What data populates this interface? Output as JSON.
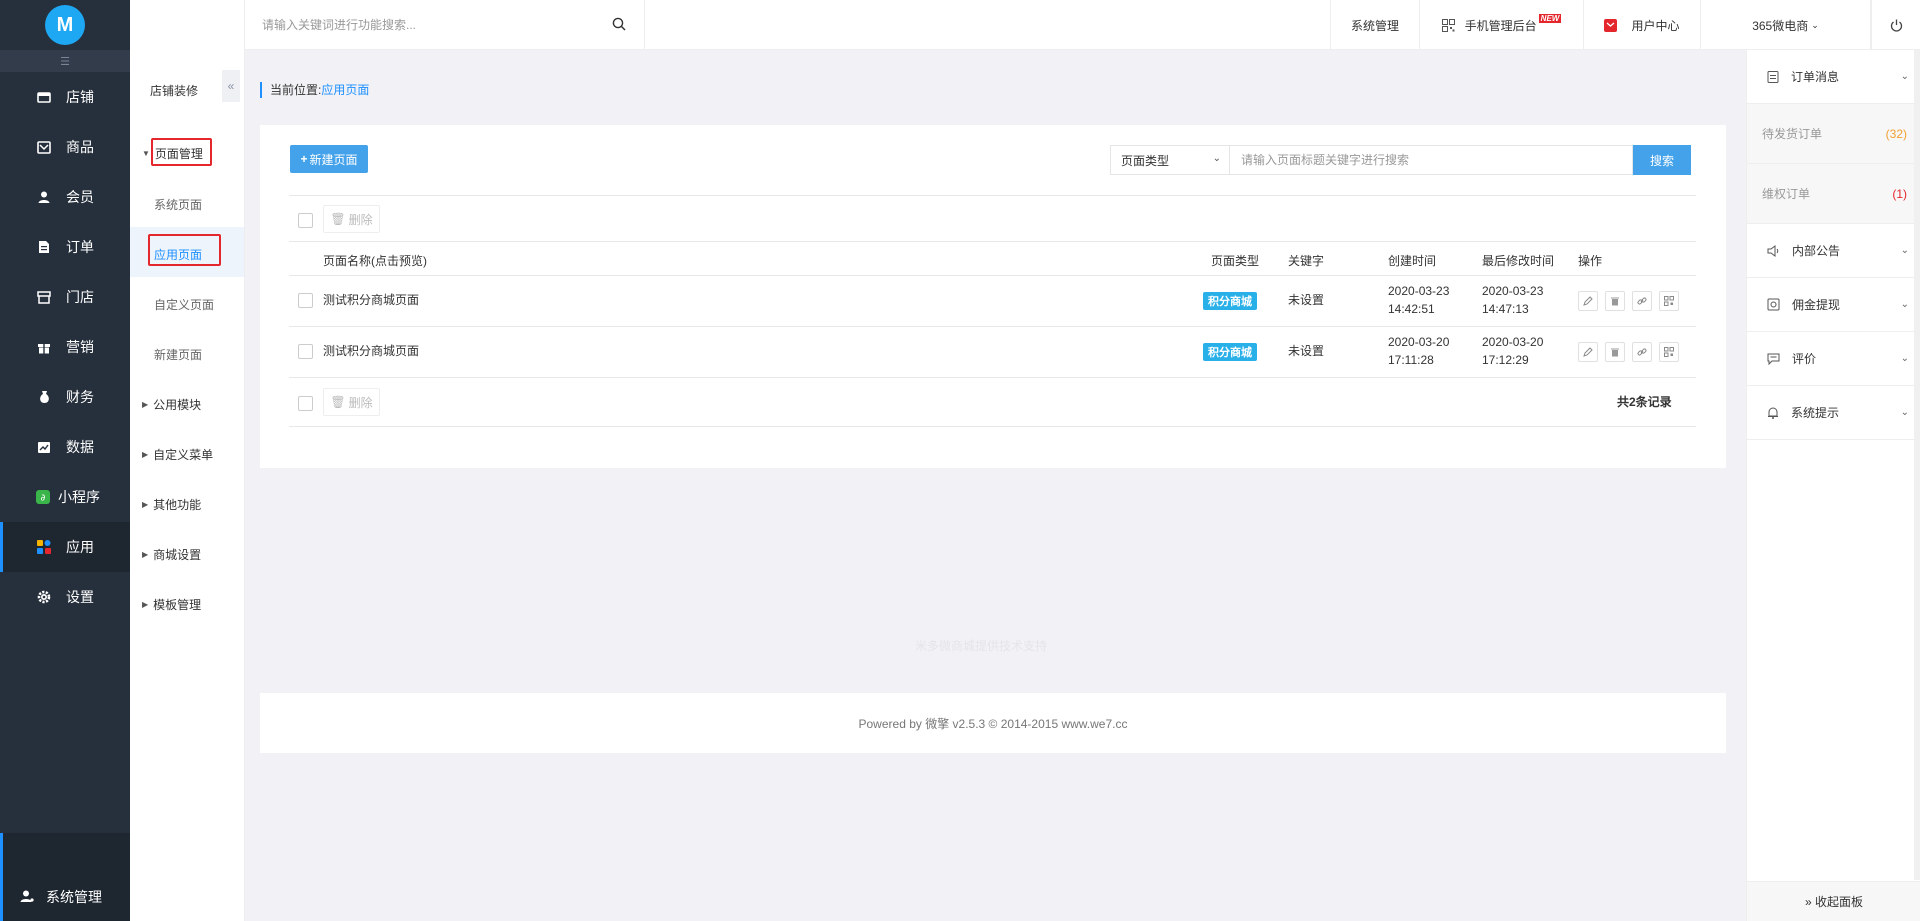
{
  "colors": {
    "sidebar_bg": "#262f3c",
    "accent": "#1e90ff",
    "button_blue": "#44a2ea",
    "tag_blue": "#2ab0e8",
    "highlight_red": "#e4262d",
    "count_orange": "#f0a030"
  },
  "logo": {
    "text": "M"
  },
  "sidebar": {
    "fold_icon": "indent-icon",
    "items": [
      {
        "label": "店铺",
        "icon": "store-icon"
      },
      {
        "label": "商品",
        "icon": "goods-icon"
      },
      {
        "label": "会员",
        "icon": "member-icon"
      },
      {
        "label": "订单",
        "icon": "order-icon"
      },
      {
        "label": "门店",
        "icon": "shop-icon"
      },
      {
        "label": "营销",
        "icon": "gift-icon"
      },
      {
        "label": "财务",
        "icon": "money-bag-icon"
      },
      {
        "label": "数据",
        "icon": "chart-icon"
      },
      {
        "label": "小程序",
        "icon": "mini-program-icon"
      },
      {
        "label": "应用",
        "icon": "apps-icon"
      },
      {
        "label": "设置",
        "icon": "gear-icon"
      }
    ],
    "active_index": 9,
    "bottom": {
      "label": "系统管理",
      "icon": "user-admin-icon"
    }
  },
  "submenu": {
    "title": "店铺装修",
    "groups": [
      {
        "label": "页面管理",
        "expanded": true,
        "children": [
          "系统页面",
          "应用页面",
          "自定义页面",
          "新建页面"
        ]
      },
      {
        "label": "公用模块"
      },
      {
        "label": "自定义菜单"
      },
      {
        "label": "其他功能"
      },
      {
        "label": "商城设置"
      },
      {
        "label": "模板管理"
      }
    ],
    "active_child": "应用页面"
  },
  "topbar": {
    "search_placeholder": "请输入关键词进行功能搜索...",
    "system_manage": "系统管理",
    "mobile_admin": "手机管理后台",
    "new_badge": "NEW",
    "user_center": "用户中心",
    "shop_name": "365微电商"
  },
  "breadcrumb": {
    "prefix": "当前位置:",
    "current": "应用页面"
  },
  "toolbar": {
    "new_button": "新建页面",
    "type_select": "页面类型",
    "keyword_placeholder": "请输入页面标题关键字进行搜索",
    "search_button": "搜索",
    "delete_button": "删除"
  },
  "table": {
    "headers": [
      "页面名称(点击预览)",
      "页面类型",
      "关键字",
      "创建时间",
      "最后修改时间",
      "操作"
    ],
    "rows": [
      {
        "name": "测试积分商城页面",
        "type": "积分商城",
        "keyword": "未设置",
        "created_date": "2020-03-23",
        "created_time": "14:42:51",
        "modified_date": "2020-03-23",
        "modified_time": "14:47:13"
      },
      {
        "name": "测试积分商城页面",
        "type": "积分商城",
        "keyword": "未设置",
        "created_date": "2020-03-20",
        "created_time": "17:11:28",
        "modified_date": "2020-03-20",
        "modified_time": "17:12:29"
      }
    ],
    "total": "共2条记录"
  },
  "watermark": "米多微商城提供技术支持",
  "footer": "Powered by 微擎 v2.5.3 © 2014-2015 www.we7.cc",
  "right_panel": {
    "order_msg": "订单消息",
    "pending_ship": {
      "label": "待发货订单",
      "count": "(32)"
    },
    "rights_orders": {
      "label": "维权订单",
      "count": "(1)"
    },
    "notice": "内部公告",
    "commission": "佣金提现",
    "review": "评价",
    "system_tip": "系统提示",
    "collapse": "» 收起面板"
  }
}
